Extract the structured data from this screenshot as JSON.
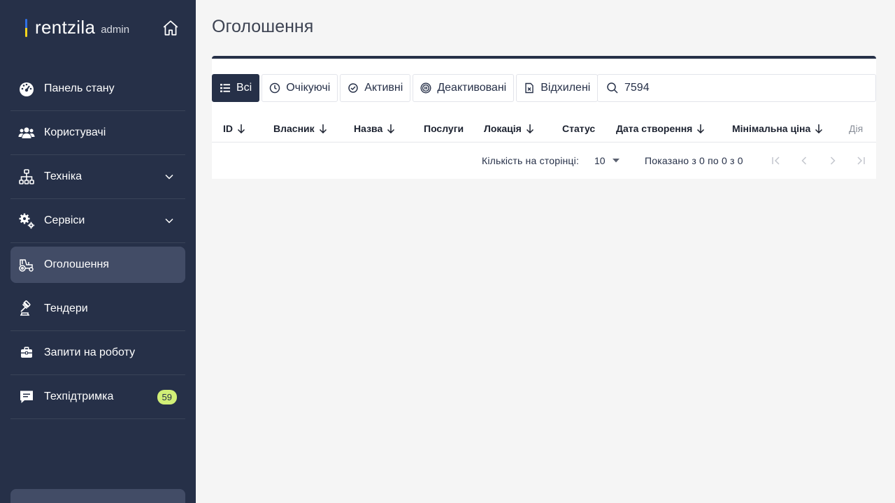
{
  "brand": {
    "name": "rentzila",
    "suffix": "admin"
  },
  "sidebar": {
    "items": [
      {
        "label": "Панель стану",
        "icon": "dashboard-icon"
      },
      {
        "label": "Користувачі",
        "icon": "users-icon"
      },
      {
        "label": "Техніка",
        "icon": "hierarchy-icon",
        "expandable": true
      },
      {
        "label": "Сервіси",
        "icon": "gears-icon",
        "expandable": true
      },
      {
        "label": "Оголошення",
        "icon": "tractor-icon",
        "active": true
      },
      {
        "label": "Тендери",
        "icon": "gavel-icon"
      },
      {
        "label": "Запити на роботу",
        "icon": "briefcase-icon"
      },
      {
        "label": "Техпідтримка",
        "icon": "chat-icon",
        "badge": "59"
      }
    ]
  },
  "page": {
    "title": "Оголошення"
  },
  "tabs": [
    {
      "label": "Всі",
      "icon": "list-icon",
      "active": true
    },
    {
      "label": "Очікуючі",
      "icon": "clock-icon"
    },
    {
      "label": "Активні",
      "icon": "check-circle-icon"
    },
    {
      "label": "Деактивовані",
      "icon": "pause-circle-icon"
    },
    {
      "label": "Відхилені",
      "icon": "file-x-icon"
    }
  ],
  "search": {
    "value": "7594",
    "icon": "search-icon"
  },
  "table": {
    "columns": [
      {
        "label": "ID",
        "sortable": true
      },
      {
        "label": "Власник",
        "sortable": true
      },
      {
        "label": "Назва",
        "sortable": true
      },
      {
        "label": "Послуги",
        "sortable": false
      },
      {
        "label": "Локація",
        "sortable": true
      },
      {
        "label": "Статус",
        "sortable": false
      },
      {
        "label": "Дата створення",
        "sortable": true
      },
      {
        "label": "Мінімальна ціна",
        "sortable": true
      },
      {
        "label": "Дія",
        "sortable": false
      }
    ],
    "rows": []
  },
  "pagination": {
    "per_page_label": "Кількість на сторінці:",
    "per_page_value": "10",
    "info": "Показано з 0 по 0 з 0"
  },
  "colors": {
    "sidebar_bg": "#263048",
    "accent": "#263048",
    "badge_bg": "#d1ef77",
    "active_item_bg": "#424c66"
  }
}
